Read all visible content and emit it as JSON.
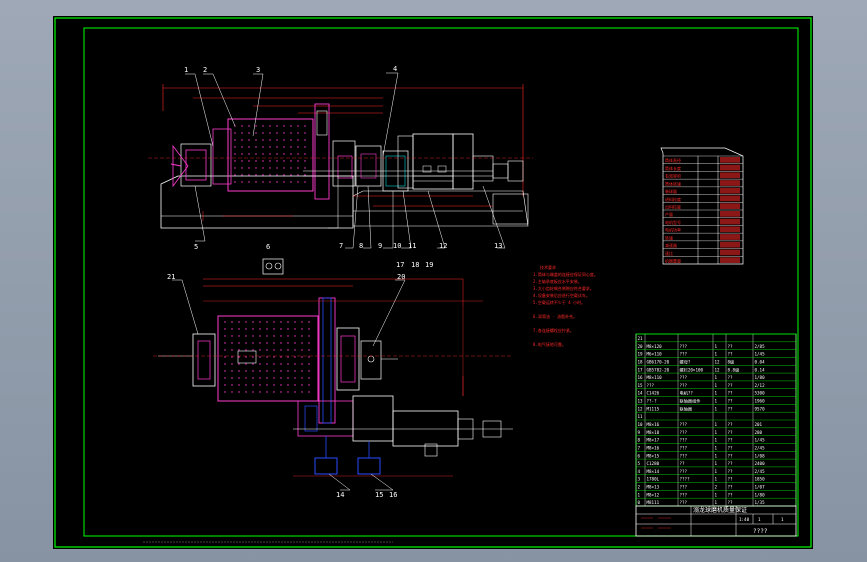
{
  "drawing": {
    "part_labels_top": [
      "1",
      "2",
      "3",
      "4",
      "5",
      "6",
      "7",
      "8",
      "9",
      "10",
      "11",
      "12",
      "13",
      "17",
      "18",
      "19"
    ],
    "part_labels_bottom": [
      "14",
      "15",
      "16",
      "20",
      "21"
    ],
    "title_text": "溺龙球磨机质量保证",
    "drawing_number": "????",
    "sheet_info": [
      "1:40",
      "1",
      "1"
    ]
  },
  "parts_list": {
    "rows": [
      {
        "no": "21",
        "code": "",
        "name": "",
        "qty": "",
        "mat": "",
        "note": ""
      },
      {
        "no": "20",
        "code": "M8×120",
        "name": "???",
        "qty": "1",
        "mat": "??",
        "note": "2/85"
      },
      {
        "no": "19",
        "code": "M6×110",
        "name": "???",
        "qty": "1",
        "mat": "??",
        "note": "1/45"
      },
      {
        "no": "18",
        "code": "GB6170-20",
        "name": "螺母?",
        "qty": "12",
        "mat": "8级",
        "note": "0.04"
      },
      {
        "no": "17",
        "code": "GB5782-20",
        "name": "螺栏20×100",
        "qty": "12",
        "mat": "8.8级",
        "note": "0.14"
      },
      {
        "no": "16",
        "code": "M8×110",
        "name": "???",
        "qty": "1",
        "mat": "??",
        "note": "1/80"
      },
      {
        "no": "15",
        "code": "???",
        "name": "???",
        "qty": "1",
        "mat": "??",
        "note": "2/12"
      },
      {
        "no": "14",
        "code": "C1426",
        "name": "电机??",
        "qty": "1",
        "mat": "??",
        "note": "5300"
      },
      {
        "no": "13",
        "code": "??-?",
        "name": "联轴器组件",
        "qty": "1",
        "mat": "??",
        "note": "1960"
      },
      {
        "no": "12",
        "code": "M1115",
        "name": "联轴器",
        "qty": "1",
        "mat": "??",
        "note": "9570"
      },
      {
        "no": "11",
        "code": "",
        "name": "",
        "qty": "",
        "mat": "",
        "note": ""
      },
      {
        "no": "10",
        "code": "M8×16",
        "name": "???",
        "qty": "1",
        "mat": "??",
        "note": "201"
      },
      {
        "no": "9",
        "code": "M8×18",
        "name": "???",
        "qty": "1",
        "mat": "??",
        "note": "280"
      },
      {
        "no": "8",
        "code": "M8×17",
        "name": "???",
        "qty": "1",
        "mat": "??",
        "note": "1/45"
      },
      {
        "no": "7",
        "code": "M8×16",
        "name": "???",
        "qty": "1",
        "mat": "??",
        "note": "2/45"
      },
      {
        "no": "6",
        "code": "M8×15",
        "name": "???",
        "qty": "1",
        "mat": "??",
        "note": "1/08"
      },
      {
        "no": "5",
        "code": "C1280",
        "name": "??",
        "qty": "1",
        "mat": "??",
        "note": "2400"
      },
      {
        "no": "4",
        "code": "M8×14",
        "name": "???",
        "qty": "1",
        "mat": "??",
        "note": "2/45"
      },
      {
        "no": "3",
        "code": "1780L",
        "name": "????",
        "qty": "1",
        "mat": "??",
        "note": "1850"
      },
      {
        "no": "2",
        "code": "M8×13",
        "name": "???",
        "qty": "2",
        "mat": "??",
        "note": "1/07"
      },
      {
        "no": "1",
        "code": "M8×12",
        "name": "???",
        "qty": "1",
        "mat": "??",
        "note": "1/80"
      },
      {
        "no": "0",
        "code": "M8111",
        "name": "???",
        "qty": "1",
        "mat": "??",
        "note": "1/35"
      }
    ],
    "header": [
      "序",
      "代号",
      "名称",
      "数量",
      "材料",
      "备注"
    ]
  },
  "spec_table": {
    "rows": [
      "筒体直径",
      "筒体长度",
      "有效容积",
      "筒体转速",
      "装球量",
      "进料粒度",
      "出料粒度",
      "产量",
      "电机型号",
      "电机功率",
      "转速",
      "减速器",
      "速比",
      "机器重量"
    ]
  },
  "notes": {
    "heading": "技术要求",
    "lines": [
      "1.筒体与端盖的连接应保证同心度。",
      "2.主轴承底板应水平安装。",
      "3.大小齿轮啁合侧隙应符合要求。",
      "4.设备安装后应进行空载试车。",
      "5.空载运转不少于 4 小时。",
      "6.润滑油 · 油脂补充。",
      "7.各连接螺栓应拧紧。",
      "8.电气接地可靠。"
    ]
  },
  "colors": {
    "frame": "#00ff00",
    "ink": "#ffffff",
    "dim": "#ff2a2a",
    "mill": "#ff3bd0",
    "blue": "#2a4bff",
    "cyan": "#00ffff"
  }
}
